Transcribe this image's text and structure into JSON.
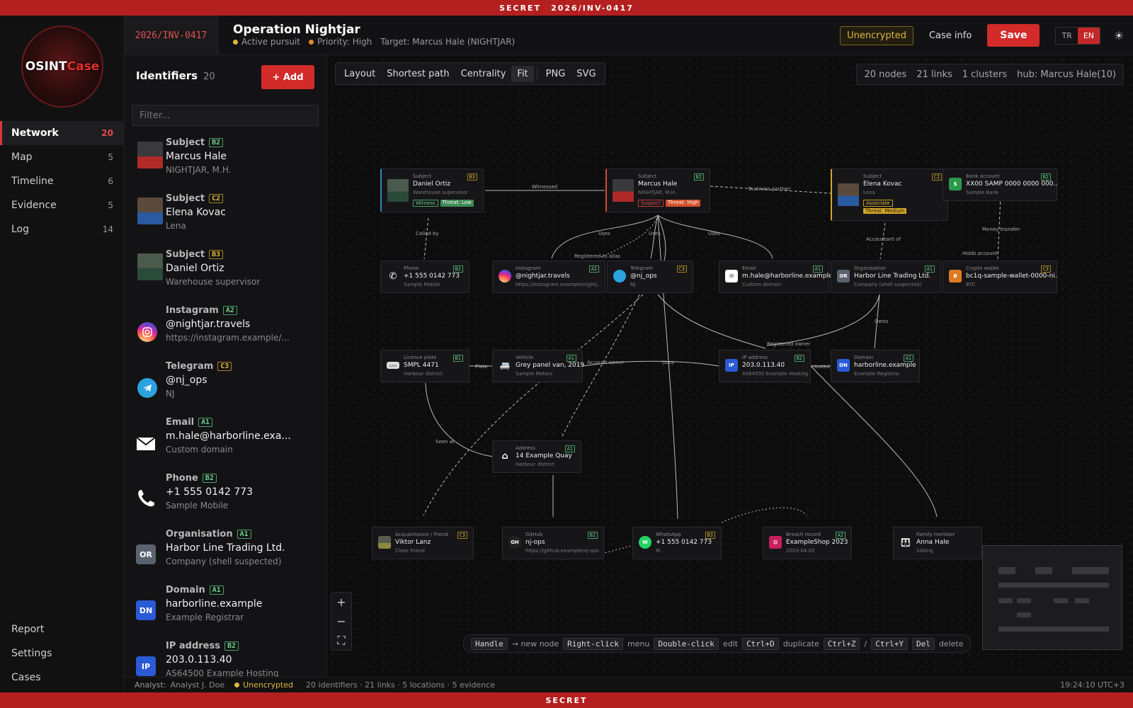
{
  "banner": {
    "classification": "SECRET",
    "case_id": "2026/INV-0417",
    "footer": "SECRET"
  },
  "logo": {
    "text1": "OSINT",
    "text2": "Case"
  },
  "nav": {
    "items": [
      {
        "label": "Network",
        "count": "20"
      },
      {
        "label": "Map",
        "count": "5"
      },
      {
        "label": "Timeline",
        "count": "6"
      },
      {
        "label": "Evidence",
        "count": "5"
      },
      {
        "label": "Log",
        "count": "14"
      }
    ],
    "bottom": [
      {
        "label": "Report"
      },
      {
        "label": "Settings"
      },
      {
        "label": "Cases"
      }
    ]
  },
  "header": {
    "case_id": "2026/INV-0417",
    "title": "Operation Nightjar",
    "status": "Active pursuit",
    "priority": "Priority: High",
    "target": "Target: Marcus Hale (NIGHTJAR)",
    "encryption": "Unencrypted",
    "case_info": "Case info",
    "save": "Save",
    "lang_tr": "TR",
    "lang_en": "EN",
    "colors": {
      "status_dot": "#e0b840",
      "priority_dot": "#e08a30"
    }
  },
  "identifiers": {
    "title": "Identifiers",
    "count": "20",
    "add_label": "+ Add",
    "filter_placeholder": "Filter...",
    "items": [
      {
        "type": "Subject",
        "grade": "B2",
        "value": "Marcus Hale",
        "sub": "NIGHTJAR, M.H.",
        "icon": "person-photo"
      },
      {
        "type": "Subject",
        "grade": "C2",
        "value": "Elena Kovac",
        "sub": "Lena",
        "icon": "person-photo"
      },
      {
        "type": "Subject",
        "grade": "B3",
        "value": "Daniel Ortiz",
        "sub": "Warehouse supervisor",
        "icon": "person-photo"
      },
      {
        "type": "Instagram",
        "grade": "A2",
        "value": "@nightjar.travels",
        "sub": "https://instagram.example/...",
        "icon": "instagram-icon"
      },
      {
        "type": "Telegram",
        "grade": "C3",
        "value": "@nj_ops",
        "sub": "NJ",
        "icon": "telegram-icon"
      },
      {
        "type": "Email",
        "grade": "A1",
        "value": "m.hale@harborline.exa...",
        "sub": "Custom domain",
        "icon": "email-icon"
      },
      {
        "type": "Phone",
        "grade": "B2",
        "value": "+1 555 0142 773",
        "sub": "Sample Mobile",
        "icon": "phone-icon"
      },
      {
        "type": "Organisation",
        "grade": "A1",
        "value": "Harbor Line Trading Ltd.",
        "sub": "Company (shell suspected)",
        "icon": "OR"
      },
      {
        "type": "Domain",
        "grade": "A1",
        "value": "harborline.example",
        "sub": "Example Registrar",
        "icon": "DN"
      },
      {
        "type": "IP address",
        "grade": "B2",
        "value": "203.0.113.40",
        "sub": "AS64500 Example Hosting",
        "icon": "IP"
      }
    ]
  },
  "toolbar": {
    "layout": "Layout",
    "shortest_path": "Shortest path",
    "centrality": "Centrality",
    "fit": "Fit",
    "png": "PNG",
    "svg": "SVG"
  },
  "stats": {
    "nodes": "20 nodes",
    "links": "21 links",
    "clusters": "1 clusters",
    "hub": "hub: Marcus Hale(10)"
  },
  "graph": {
    "nodes": [
      {
        "id": "n1",
        "type": "Subject",
        "value": "Daniel Ortiz",
        "sub": "Warehouse supervisor",
        "grade": "B3",
        "tags": [
          "Witness",
          "Threat: Low"
        ]
      },
      {
        "id": "n2",
        "type": "Subject",
        "value": "Marcus Hale",
        "sub": "NIGHTJAR, M.H.",
        "grade": "B2",
        "tags": [
          "Suspect",
          "Threat: High"
        ]
      },
      {
        "id": "n3",
        "type": "Subject",
        "value": "Elena Kovac",
        "sub": "Lena",
        "grade": "C2",
        "tags": [
          "Associate",
          "Threat: Medium"
        ]
      },
      {
        "id": "n4",
        "type": "Bank account",
        "value": "XX00 SAMP 0000 0000 000...",
        "sub": "Sample Bank",
        "grade": "B2"
      },
      {
        "id": "n5",
        "type": "Phone",
        "value": "+1 555 0142 773",
        "sub": "Sample Mobile",
        "grade": "B2"
      },
      {
        "id": "n6",
        "type": "Instagram",
        "value": "@nightjar.travels",
        "sub": "https://instagram.example/nightj...",
        "grade": "A2"
      },
      {
        "id": "n7",
        "type": "Telegram",
        "value": "@nj_ops",
        "sub": "NJ",
        "grade": "C3"
      },
      {
        "id": "n8",
        "type": "Email",
        "value": "m.hale@harborline.example",
        "sub": "Custom domain",
        "grade": "A1"
      },
      {
        "id": "n9",
        "type": "Organisation",
        "value": "Harbor Line Trading Ltd.",
        "sub": "Company (shell suspected)",
        "grade": "A1"
      },
      {
        "id": "n10",
        "type": "Crypto wallet",
        "value": "bc1q-sample-wallet-0000-ni...",
        "sub": "BTC",
        "grade": "C3"
      },
      {
        "id": "n11",
        "type": "Licence plate",
        "value": "SMPL 4471",
        "sub": "Harbour district",
        "grade": "B1"
      },
      {
        "id": "n12",
        "type": "Vehicle",
        "value": "Grey panel van, 2019",
        "sub": "Sample Motors",
        "grade": "A1"
      },
      {
        "id": "n13",
        "type": "IP address",
        "value": "203.0.113.40",
        "sub": "AS64500 Example Hosting",
        "grade": "B2"
      },
      {
        "id": "n14",
        "type": "Domain",
        "value": "harborline.example",
        "sub": "Example Registrar",
        "grade": "A1"
      },
      {
        "id": "n15",
        "type": "Address",
        "value": "14 Example Quay",
        "sub": "Harbour district",
        "grade": "A1"
      },
      {
        "id": "n16",
        "type": "Acquaintance / friend",
        "value": "Viktor Lanz",
        "sub": "Close friend",
        "grade": "C3"
      },
      {
        "id": "n17",
        "type": "GitHub",
        "value": "nj-ops",
        "sub": "https://github.example/nj-ops",
        "grade": "B2"
      },
      {
        "id": "n18",
        "type": "WhatsApp",
        "value": "+1 555 0142 773",
        "sub": "M.",
        "grade": "B3"
      },
      {
        "id": "n19",
        "type": "Breach record",
        "value": "ExampleShop 2023",
        "sub": "2023-04-02",
        "grade": "A2"
      },
      {
        "id": "n20",
        "type": "Family member",
        "value": "Anna Hale",
        "sub": "Sibling",
        "grade": ""
      }
    ],
    "edge_labels": [
      "Witnessed",
      "Business partner",
      "Called by",
      "Uses",
      "Uses",
      "Uses",
      "Registered to alias",
      "Accountant of",
      "Money transfer",
      "Holds account",
      "Owns",
      "Registered owner",
      "Plate",
      "Account owner",
      "Uses",
      "Hosted",
      "Seen at"
    ]
  },
  "hints": [
    {
      "key": "Handle",
      "text": "→ new node"
    },
    {
      "key": "Right-click",
      "text": "menu"
    },
    {
      "key": "Double-click",
      "text": "edit"
    },
    {
      "key": "Ctrl+D",
      "text": "duplicate"
    },
    {
      "key": "Ctrl+Z",
      "text": "/"
    },
    {
      "key": "Ctrl+Y",
      "text": ""
    },
    {
      "key": "Del",
      "text": "delete"
    }
  ],
  "status": {
    "analyst_label": "Analyst:",
    "analyst": "Analyst J. Doe",
    "encryption": "Unencrypted",
    "summary": "20 identifiers · 21 links · 5 locations · 5 evidence",
    "time": "19:24:10 UTC+3"
  }
}
